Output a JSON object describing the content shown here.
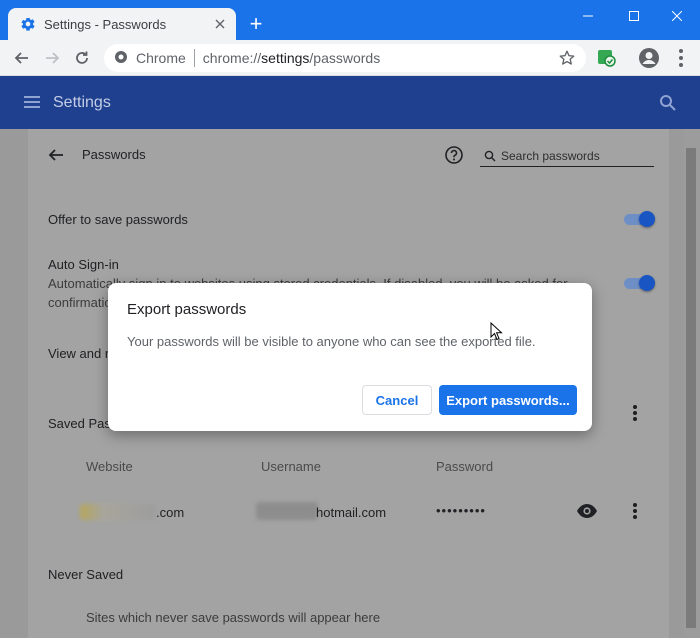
{
  "browser": {
    "tab_title": "Settings - Passwords",
    "new_tab_label": "+",
    "omnibox": {
      "site_name": "Chrome",
      "url_prefix": "chrome://",
      "url_host": "settings",
      "url_path": "/passwords"
    }
  },
  "settings": {
    "header_title": "Settings"
  },
  "passwords_page": {
    "title": "Passwords",
    "search_placeholder": "Search passwords",
    "offer_to_save": {
      "label": "Offer to save passwords",
      "enabled": true
    },
    "auto_signin": {
      "label": "Auto Sign-in",
      "desc_line1": "Automatically sign in to websites using stored credentials. If disabled, you will be asked for",
      "desc_line2": "confirmation",
      "enabled": true
    },
    "view_manage_partial": "View and m",
    "saved_section_partial": "Saved Pas",
    "columns": {
      "website": "Website",
      "username": "Username",
      "password": "Password"
    },
    "saved_rows": [
      {
        "website": ".com",
        "username": "hotmail.com",
        "password": "•••••••••"
      }
    ],
    "never_saved": {
      "heading": "Never Saved",
      "empty_text": "Sites which never save passwords will appear here"
    }
  },
  "dialog": {
    "title": "Export passwords",
    "body": "Your passwords will be visible to anyone who can see the exported file.",
    "cancel_label": "Cancel",
    "export_label": "Export passwords..."
  },
  "colors": {
    "accent": "#1a73e8",
    "settings_header": "#1f3f8f",
    "titlebar": "#1a73e8"
  },
  "icons": [
    "settings-gear-icon",
    "close-icon",
    "back-icon",
    "forward-icon",
    "reload-icon",
    "site-info-icon",
    "star-icon",
    "extension-icon",
    "profile-icon",
    "more-icon",
    "hamburger-icon",
    "search-icon",
    "help-icon",
    "eye-icon",
    "kebab-icon"
  ]
}
